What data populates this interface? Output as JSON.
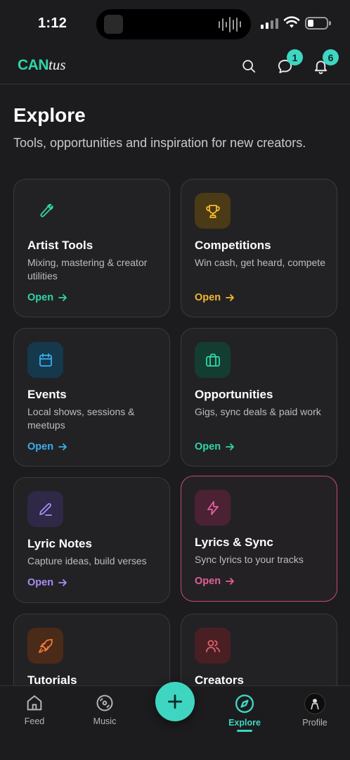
{
  "status_bar": {
    "time": "1:12",
    "battery_level": 0.3
  },
  "header": {
    "logo_part1": "CAN",
    "logo_part2": "tus",
    "messages_badge": "1",
    "notifications_badge": "6"
  },
  "page": {
    "title": "Explore",
    "subtitle": "Tools, opportunities and inspiration for new creators."
  },
  "cards": [
    {
      "title": "Artist Tools",
      "description": "Mixing, mastering & creator utilities",
      "cta": "Open",
      "icon": "wrench-icon",
      "accent": "#2fd6a8"
    },
    {
      "title": "Competitions",
      "description": "Win cash, get heard, compete",
      "cta": "Open",
      "icon": "trophy-icon",
      "accent": "#f5b82e"
    },
    {
      "title": "Events",
      "description": "Local shows, sessions & meetups",
      "cta": "Open",
      "icon": "calendar-icon",
      "accent": "#3aaef0"
    },
    {
      "title": "Opportunities",
      "description": "Gigs, sync deals & paid work",
      "cta": "Open",
      "icon": "briefcase-icon",
      "accent": "#2fd6a8"
    },
    {
      "title": "Lyric Notes",
      "description": "Capture ideas, build verses",
      "cta": "Open",
      "icon": "pen-icon",
      "accent": "#a98cf5"
    },
    {
      "title": "Lyrics & Sync",
      "description": "Sync lyrics to your tracks",
      "cta": "Open",
      "icon": "lightning-icon",
      "accent": "#e0609a"
    },
    {
      "title": "Tutorials",
      "icon": "rocket-icon",
      "accent": "#f07a3a"
    },
    {
      "title": "Creators",
      "icon": "users-icon",
      "accent": "#e0616a"
    }
  ],
  "nav": {
    "feed": "Feed",
    "music": "Music",
    "explore": "Explore",
    "profile": "Profile"
  }
}
